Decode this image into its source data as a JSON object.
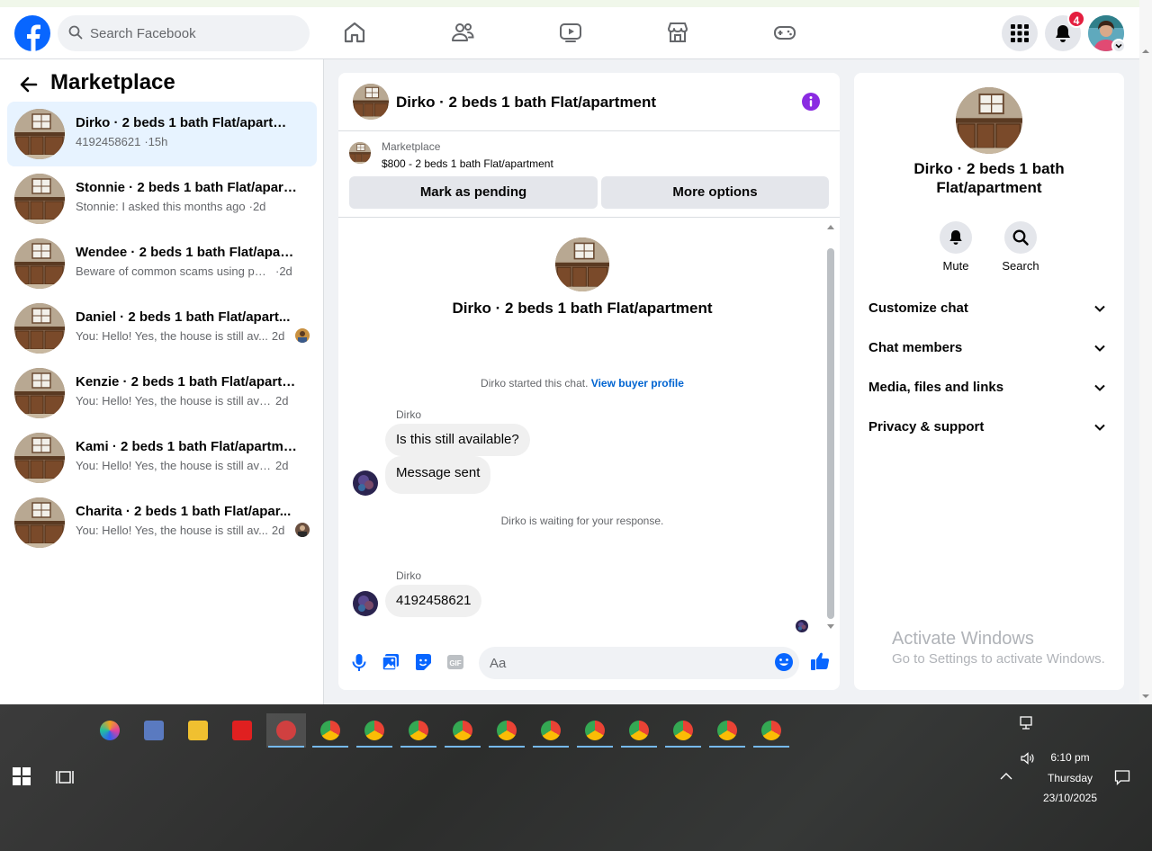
{
  "topbar": {
    "search_placeholder": "Search Facebook",
    "notification_count": "4"
  },
  "sidebar": {
    "title": "Marketplace",
    "conversations": [
      {
        "title": "Dirko · 2 beds 1 bath Flat/apartment",
        "preview": "4192458621",
        "time": "·15h",
        "active": true
      },
      {
        "title": "Stonnie · 2 beds 1 bath Flat/apart...",
        "preview": "Stonnie: I asked this months ago",
        "time": "·2d"
      },
      {
        "title": "Wendee · 2 beds 1 bath Flat/apart...",
        "preview": "Beware of common scams using pay...",
        "time": "·2d"
      },
      {
        "title": "Daniel · 2 beds 1 bath Flat/apart...",
        "preview": "You: Hello! Yes, the house is still av...",
        "time": "2d"
      },
      {
        "title": "Kenzie · 2 beds 1 bath Flat/apartm...",
        "preview": "You: Hello! Yes, the house is still availa...",
        "time": "2d"
      },
      {
        "title": "Kami · 2 beds 1 bath Flat/apartment",
        "preview": "You: Hello! Yes, the house is still availa...",
        "time": "2d"
      },
      {
        "title": "Charita · 2 beds 1 bath Flat/apar...",
        "preview": "You: Hello! Yes, the house is still av...",
        "time": "2d"
      }
    ]
  },
  "chat": {
    "header_title": "Dirko · 2 beds 1 bath Flat/apartment",
    "listing_label": "Marketplace",
    "listing_price": "$800 - 2 beds 1 bath Flat/apartment",
    "mark_pending": "Mark as pending",
    "more_options": "More options",
    "hero_title": "Dirko · 2 beds 1 bath Flat/apartment",
    "started_text": "Dirko started this chat.",
    "view_profile": "View buyer profile",
    "sender1": "Dirko",
    "msg1": "Is this still available?",
    "msg2": "Message sent",
    "waiting": "Dirko is waiting for your response.",
    "sender2": "Dirko",
    "msg3": "4192458621",
    "composer_placeholder": "Aa"
  },
  "rpanel": {
    "title": "Dirko · 2 beds 1 bath Flat/apartment",
    "mute": "Mute",
    "search": "Search",
    "rows": [
      "Customize chat",
      "Chat members",
      "Media, files and links",
      "Privacy & support"
    ]
  },
  "watermark": {
    "line1": "Activate Windows",
    "line2": "Go to Settings to activate Windows."
  },
  "taskbar": {
    "time": "6:10 pm",
    "day": "Thursday",
    "date": "23/10/2025"
  },
  "colors": {
    "brand": "#0866ff",
    "active_row": "#e7f3ff",
    "info": "#8a2be2",
    "badge": "#e41e3f"
  }
}
